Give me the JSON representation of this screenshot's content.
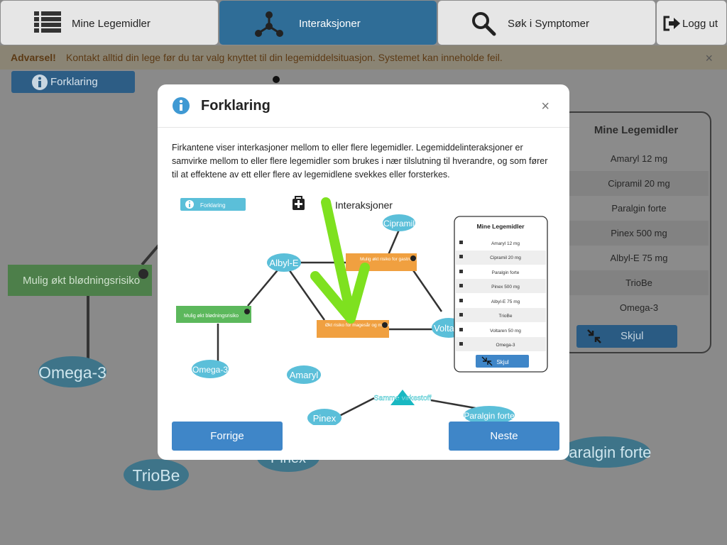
{
  "nav": {
    "items": [
      {
        "label": "Mine Legemidler",
        "icon": "list-icon"
      },
      {
        "label": "Interaksjoner",
        "icon": "network-icon"
      },
      {
        "label": "Søk i Symptomer",
        "icon": "search-icon"
      },
      {
        "label": "Logg ut",
        "icon": "logout-icon"
      }
    ],
    "active_color": "#2f6d97"
  },
  "warning": {
    "title": "Advarsel!",
    "message": "Kontakt alltid din lege før du tar valg knyttet til din legemiddelsituasjon. Systemet kan inneholde feil.",
    "close": "×"
  },
  "background": {
    "forklaring_label": "Forklaring",
    "graph": {
      "interaction_label": "Mulig økt blødningsrisiko",
      "nodes": [
        "Omega-3",
        "TrioBe",
        "Pinex",
        "Paralgin forte"
      ]
    },
    "panel": {
      "title": "Mine Legemidler",
      "items": [
        "Amaryl 12 mg",
        "Cipramil 20 mg",
        "Paralgin forte",
        "Pinex 500 mg",
        "Albyl-E 75 mg",
        "TrioBe",
        "Omega-3"
      ],
      "hide_label": "Skjul"
    }
  },
  "modal": {
    "title": "Forklaring",
    "close": "×",
    "text": "Firkantene viser interkasjoner mellom to eller flere legemidler. Legemiddelinteraksjoner er samvirke mellom to eller flere legemidler som brukes i nær tilslutning til hverandre, og som fører til at effektene av ett eller flere av legemidlene svekkes eller forsterkes.",
    "prev_label": "Forrige",
    "next_label": "Neste",
    "illustration": {
      "forklaring_label": "Forklaring",
      "interactions_title": "Interaksjoner",
      "drug_nodes": [
        "Cipramil",
        "Albyl-E",
        "Omega-3",
        "Amaryl",
        "Voltaren",
        "Pinex",
        "Paralgin forte"
      ],
      "interaction_boxes": [
        "Mulig økt risiko for gastrointestinal blødning",
        "Mulig økt blødningsrisiko",
        "Økt risiko for magesår og mageblødning"
      ],
      "same_substance_label": "Samme virkestoff",
      "panel_title": "Mine Legemidler",
      "panel_items": [
        "Amaryl 12 mg",
        "Cipramil 20 mg",
        "Paralgin forte",
        "Pinex 500 mg",
        "Albyl-E 75 mg",
        "TrioBe",
        "Voltaren 50 mg",
        "Omega-3"
      ],
      "panel_hide_label": "Skjul"
    }
  },
  "colors": {
    "primary_button": "#3f86c8",
    "node_fill": "#5bbfd9",
    "interaction_orange": "#f0a040",
    "interaction_green": "#5cb85c",
    "arrow_green": "#7ee11f",
    "same_substance": "#19b8c2"
  }
}
